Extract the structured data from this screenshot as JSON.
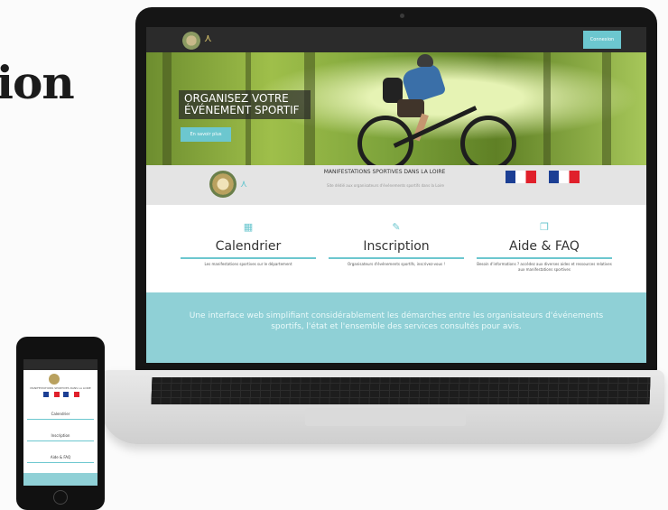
{
  "headline": "ion",
  "site": {
    "connexion_label": "Connexion",
    "hero": {
      "title": "ORGANISEZ VOTRE ÉVÉNEMENT SPORTIF",
      "button": "En savoir plus"
    },
    "band": {
      "title": "MANIFESTATIONS SPORTIVES DANS LA LOIRE",
      "subtitle": "Site dédié aux organisateurs d'événements sportifs dans la Loire"
    },
    "services": [
      {
        "icon": "calendar-icon",
        "title": "Calendrier",
        "desc": "Les manifestations sportives sur le département"
      },
      {
        "icon": "edit-icon",
        "title": "Inscription",
        "desc": "Organisateurs d'événements sportifs, inscrivez-vous !"
      },
      {
        "icon": "book-icon",
        "title": "Aide & FAQ",
        "desc": "Besoin d'informations ? accédez aux diverses aides et ressources relatives aux manifestations sportives"
      }
    ],
    "tagline": "Une interface web simplifiant considérablement les démarches entre les organisateurs d'événements sportifs, l'état et l'ensemble des services consultés pour avis."
  },
  "phone": {
    "items": [
      "Calendrier",
      "Inscription",
      "Aide & FAQ"
    ]
  },
  "colors": {
    "accent": "#6cc7cf",
    "band": "#8fd0d6"
  }
}
